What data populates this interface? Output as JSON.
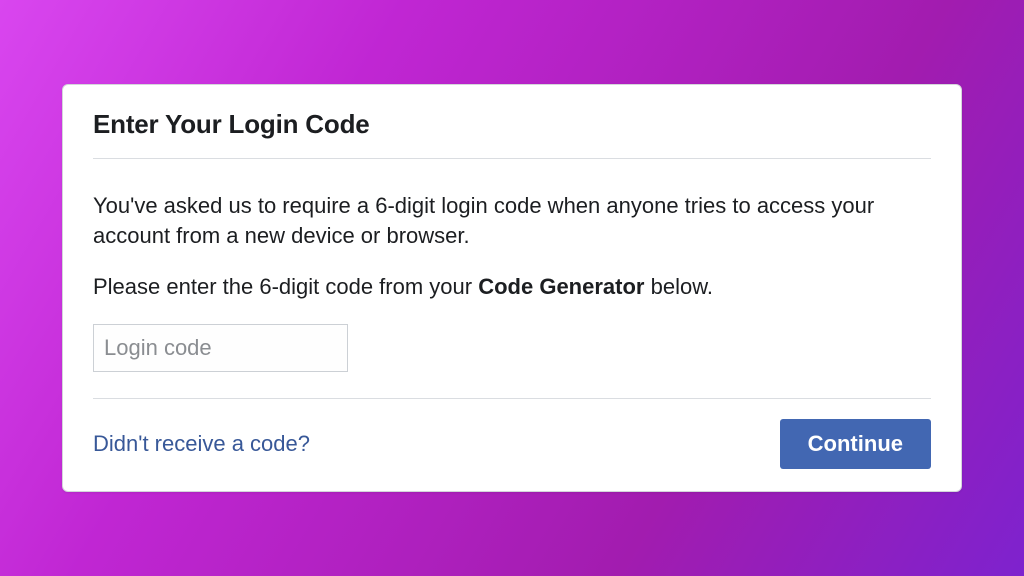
{
  "dialog": {
    "heading": "Enter Your Login Code",
    "description1": "You've asked us to require a 6-digit login code when anyone tries to access your account from a new device or browser.",
    "description2_prefix": "Please enter the 6-digit code from your ",
    "description2_bold": "Code Generator",
    "description2_suffix": " below.",
    "input_placeholder": "Login code",
    "help_link": "Didn't receive a code?",
    "continue_button": "Continue"
  }
}
